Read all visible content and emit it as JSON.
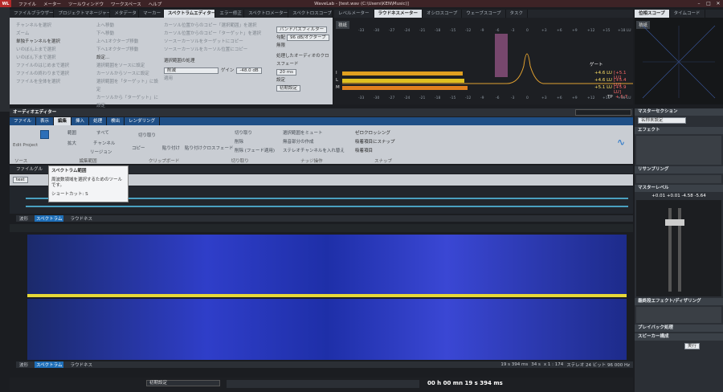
{
  "app": {
    "title": "WaveLab - [test.wav (C:\\Users\\KEN\\Music)]",
    "logo": "WL"
  },
  "menu": [
    "ファイル",
    "メーター",
    "ツールウィンドウ",
    "ワークスペース",
    "ヘルプ"
  ],
  "top_tabs": [
    "ファイルブラウザー",
    "プロジェクトマネージャー",
    "メタデータ",
    "マーカー",
    "スペクトラムエディター",
    "エラー修正",
    "スペクトロメーター",
    "スペクトロスコープ"
  ],
  "spectrum_panel": {
    "left_options": [
      "チャンネルを選択",
      "ズーム",
      "単独チャンネルを選択",
      "いのぼん上まで選択",
      "いのぼん下まで選択",
      "ファイルのはじめまで選択",
      "ファイルの終わりまで選択",
      "ファイルを全体を選択"
    ],
    "mid_options": [
      "上へ移動",
      "下へ移動",
      "上へ1オクターブ移動",
      "下へ1オクターブ移動",
      "設定..."
    ],
    "mid_options2": [
      "選択範囲をソースに設定",
      "カーソルからソースに設定",
      "選択範囲を「ターゲット」に設定",
      "カーソルから「ターゲット」に設定"
    ],
    "right_options": [
      "カーソル位置からのコピー「選択範囲」を選択",
      "カーソル位置からのコピー「ターゲット」を選択",
      "ソースーカーソルをターゲットにコピー",
      "ソースーカーソルをカーソル位置にコピー"
    ],
    "process_label": "選択範囲の処理",
    "process_value": "削減",
    "gain_label": "ゲイン",
    "gain_value": "-48.0 dB",
    "apply": "適用",
    "filter_label": "バンドパスフィルター",
    "slope_label": "勾配",
    "slope_value": "96 dB/オクターブ",
    "mute": "無限",
    "preview_label": "処理したオーディオのクロスフェード",
    "preview_value": "20 ms",
    "settings": "設定",
    "default": "初期設定"
  },
  "meter_tabs": [
    "レベルメーター",
    "ラウドネスメーター",
    "オシロスコープ",
    "ウェーブスコープ",
    "タスク"
  ],
  "meter_labels": {
    "mode": "積紙",
    "gate": "ゲート"
  },
  "meter_ticks": [
    "-33",
    "-30",
    "-27",
    "-24",
    "-21",
    "-18",
    "-15",
    "-12",
    "-9",
    "-6",
    "-3",
    "0",
    "+3",
    "+6",
    "+9",
    "+12",
    "+15",
    "+18 LU"
  ],
  "loudness": [
    {
      "name": "I",
      "value": "+4.6 LU",
      "max": "[+5.1 LU]",
      "fill": 0.65,
      "color": "#e0a020"
    },
    {
      "name": "L",
      "value": "+4.6 LU",
      "max": "[+5.4 LU]",
      "fill": 0.66,
      "color": "#e0c020"
    },
    {
      "name": "M",
      "value": "+5.1 LU",
      "max": "[+5.9 LU]",
      "fill": 0.68,
      "color": "#e08020"
    }
  ],
  "tp": "TP",
  "tp_value": "+ 6.7",
  "scope_tabs": [
    "位相スコープ",
    "タイムコード"
  ],
  "scope_mode": "積紙",
  "audio_editor": {
    "title": "オーディオエディター",
    "ribbon_tabs": [
      "ファイル",
      "表示",
      "編集",
      "挿入",
      "処理",
      "検出",
      "レンダリング"
    ],
    "tools": {
      "edit_project": "Edit Project",
      "range": "範囲",
      "zoom": "拡大",
      "all": "すべて",
      "channel": "チャンネル",
      "region": "リージョン",
      "switch": "切り替え",
      "cut": "切り取り",
      "copy": "コピー",
      "paste": "貼り付け",
      "paste_crossfade": "貼り付けクロスフェード",
      "trim": "切り取り",
      "delete": "削除",
      "delete_fade": "削除 (フェード適用)",
      "mute_sel": "選択範囲をミュート",
      "silence": "無音部分の作成",
      "stereo": "ステレオチャンネルを入れ替え",
      "zero": "ゼロクロッシング",
      "snap": "吸着項目にスナップ",
      "snap_item": "吸着項目",
      "groups": [
        "ソース",
        "編集範囲",
        "クリップボード",
        "切り取り",
        "ナッジ操作",
        "スナップ"
      ]
    },
    "tooltip": {
      "title": "スペクトラム範囲",
      "text": "周波数領域を選択するためのツールです。",
      "shortcut": "ショートカット: S"
    },
    "file_tab": "ファイルグル",
    "track": "test",
    "view_tabs": [
      "波形",
      "スペクトラム",
      "ラウドネス"
    ],
    "status": {
      "time": "19 s 394 ms",
      "zoom": "34 s",
      "ratio": "x 1 : 174",
      "format": "ステレオ 24 ビット 96 000 Hz",
      "position": "00 h 00 mn 19 s 394 ms",
      "preset": "初期設定"
    }
  },
  "master": {
    "title": "マスターセクション",
    "preset": "名称未設定",
    "effects": "エフェクト",
    "resampling": "リサンプリング",
    "level_label": "マスターレベル",
    "levels": "+0.01 +0.01 -4.58 -5.64",
    "final": "最終段エフェクト/ディザリング",
    "playback": "プレイバック処理",
    "speaker": "スピーカー構成",
    "render": "実行"
  }
}
